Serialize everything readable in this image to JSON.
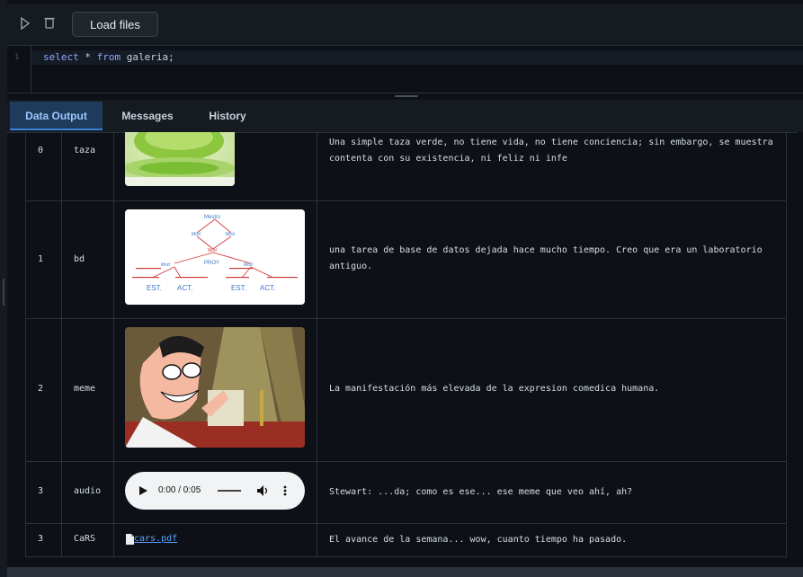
{
  "toolbar": {
    "load_label": "Load files",
    "play_icon": "play-icon",
    "trash_icon": "trash-icon"
  },
  "editor": {
    "line_number": "1",
    "kw1": "select",
    "star": " * ",
    "kw2": "from",
    "rest": " galeria;"
  },
  "tabs": [
    {
      "label": "Data Output",
      "active": true
    },
    {
      "label": "Messages",
      "active": false
    },
    {
      "label": "History",
      "active": false
    }
  ],
  "rows": [
    {
      "id": "0",
      "name": "taza",
      "media": "green cup image",
      "desc": "Una simple taza verde, no tiene vida, no tiene conciencia; sin embargo, se muestra contenta con su existencia, ni feliz ni infe"
    },
    {
      "id": "1",
      "name": "bd",
      "media": "handwritten database diagram",
      "desc": "una tarea de base de datos dejada hace mucho tiempo. Creo que era un laboratorio antiguo."
    },
    {
      "id": "2",
      "name": "meme",
      "media": "cartoon meme image",
      "desc": "La manifestación más elevada de la expresion comedica humana."
    },
    {
      "id": "3",
      "name": "audio",
      "media": "audio player",
      "desc": "Stewart: ...da; como es ese... ese meme que veo ahí, ah?"
    },
    {
      "id": "3",
      "name": "CaRS",
      "media": "pdf link",
      "desc": "El avance de la semana... wow, cuanto tiempo ha pasado."
    }
  ],
  "audio": {
    "time": "0:00 / 0:05"
  },
  "pdf": {
    "label": " cars.pdf",
    "icon": "file-icon"
  },
  "diagram": {
    "root": "Mestrs",
    "rel1": "Mod",
    "rel2": "Mod",
    "mid": "Mod",
    "proj": "PROY",
    "n1": "Mod",
    "n2": "Mod",
    "est1": "EST.",
    "act1": "ACT.",
    "est2": "EST.",
    "act2": "ACT."
  },
  "colors": {
    "accent": "#3b82d6",
    "background": "#0d1117",
    "panel": "#161b22"
  }
}
